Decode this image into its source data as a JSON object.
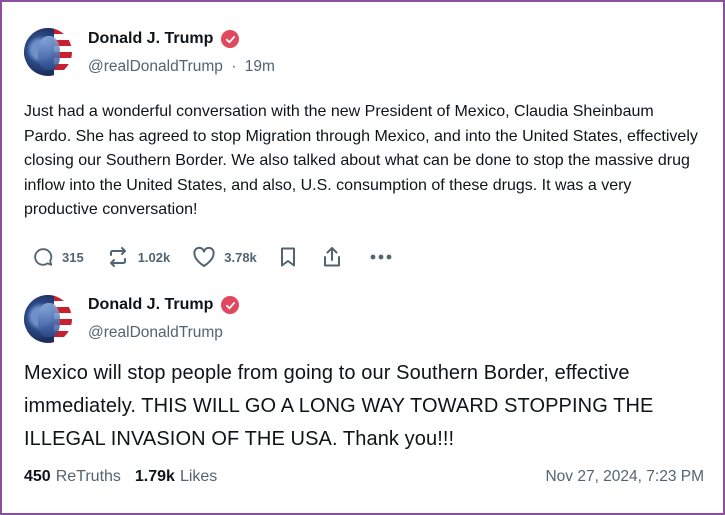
{
  "colors": {
    "border": "#8a4f9e",
    "verified": "#e0485f",
    "muted": "#536471",
    "text": "#0f1419"
  },
  "post1": {
    "author_name": "Donald J. Trump",
    "verified_icon": "verified-badge-icon",
    "handle": "@realDonaldTrump",
    "separator": "·",
    "time_ago": "19m",
    "text": "Just had a wonderful conversation with the new President of Mexico, Claudia Sheinbaum Pardo. She has agreed to stop Migration through Mexico, and into the United States, effectively closing our Southern Border. We also talked about what can be done to stop the massive drug inflow into the United States, and also, U.S. consumption of these drugs. It was a very productive conversation!",
    "actions": {
      "replies": {
        "icon": "reply-icon",
        "count": "315"
      },
      "retruths": {
        "icon": "retruth-icon",
        "count": "1.02k"
      },
      "likes": {
        "icon": "heart-icon",
        "count": "3.78k"
      },
      "bookmark": {
        "icon": "bookmark-icon"
      },
      "share": {
        "icon": "share-icon"
      },
      "more": {
        "icon": "more-icon"
      }
    }
  },
  "post2": {
    "author_name": "Donald J. Trump",
    "verified_icon": "verified-badge-icon",
    "handle": "@realDonaldTrump",
    "text": "Mexico will stop people from going to our Southern Border, effective immediately. THIS WILL GO A LONG WAY TOWARD STOPPING THE ILLEGAL INVASION OF THE USA. Thank you!!!",
    "stats": {
      "retruths_count": "450",
      "retruths_label": "ReTruths",
      "likes_count": "1.79k",
      "likes_label": "Likes"
    },
    "timestamp": "Nov 27, 2024, 7:23 PM"
  }
}
